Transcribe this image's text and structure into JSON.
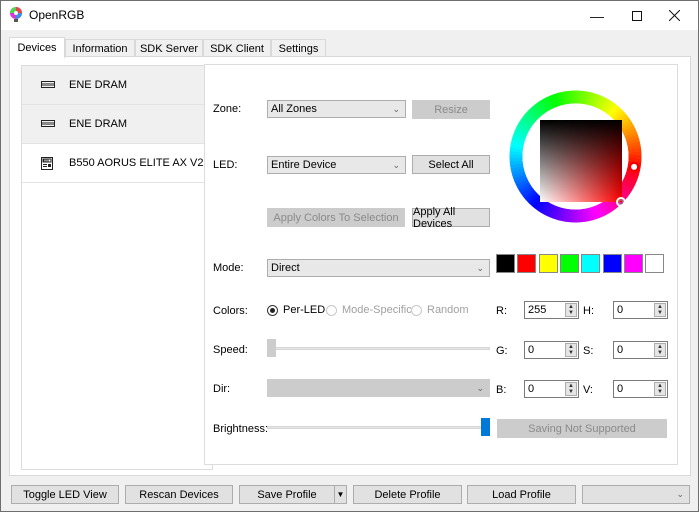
{
  "window": {
    "title": "OpenRGB",
    "icons": {
      "app": "openrgb-logo-icon",
      "minimize": "minimize-icon",
      "maximize": "maximize-icon",
      "close": "close-icon"
    }
  },
  "tabs": [
    {
      "label": "Devices",
      "active": true
    },
    {
      "label": "Information",
      "active": false
    },
    {
      "label": "SDK Server",
      "active": false
    },
    {
      "label": "SDK Client",
      "active": false
    },
    {
      "label": "Settings",
      "active": false
    }
  ],
  "devices": [
    {
      "name": "ENE DRAM",
      "icon": "ram-icon",
      "selected": false
    },
    {
      "name": "ENE DRAM",
      "icon": "ram-icon",
      "selected": false
    },
    {
      "name": "B550 AORUS ELITE AX V2",
      "icon": "motherboard-icon",
      "selected": true
    }
  ],
  "controls": {
    "zone_label": "Zone:",
    "zone_value": "All Zones",
    "resize_label": "Resize",
    "led_label": "LED:",
    "led_value": "Entire Device",
    "select_all_label": "Select All",
    "apply_selection_label": "Apply Colors To Selection",
    "apply_all_label": "Apply All Devices",
    "mode_label": "Mode:",
    "mode_value": "Direct",
    "colors_label": "Colors:",
    "color_modes": [
      {
        "label": "Per-LED",
        "checked": true,
        "enabled": true
      },
      {
        "label": "Mode-Specific",
        "checked": false,
        "enabled": false
      },
      {
        "label": "Random",
        "checked": false,
        "enabled": false
      }
    ],
    "speed_label": "Speed:",
    "speed_value": 0,
    "dir_label": "Dir:",
    "dir_value": "",
    "brightness_label": "Brightness:",
    "brightness_value": 1.0,
    "saving_label": "Saving Not Supported"
  },
  "swatches": [
    "#000000",
    "#ff0000",
    "#ffff00",
    "#00ff00",
    "#00ffff",
    "#0000ff",
    "#ff00ff",
    "#ffffff"
  ],
  "color_values": {
    "r_label": "R:",
    "r": "255",
    "g_label": "G:",
    "g": "0",
    "b_label": "B:",
    "b": "0",
    "h_label": "H:",
    "h": "0",
    "s_label": "S:",
    "s": "0",
    "v_label": "V:",
    "v": "0"
  },
  "colors": {
    "accent": "#0078d7",
    "selected_color": "#ff0000"
  },
  "bottom": {
    "toggle_led_view": "Toggle LED View",
    "rescan_devices": "Rescan Devices",
    "save_profile": "Save Profile",
    "delete_profile": "Delete Profile",
    "load_profile": "Load Profile",
    "profile_select_value": ""
  }
}
